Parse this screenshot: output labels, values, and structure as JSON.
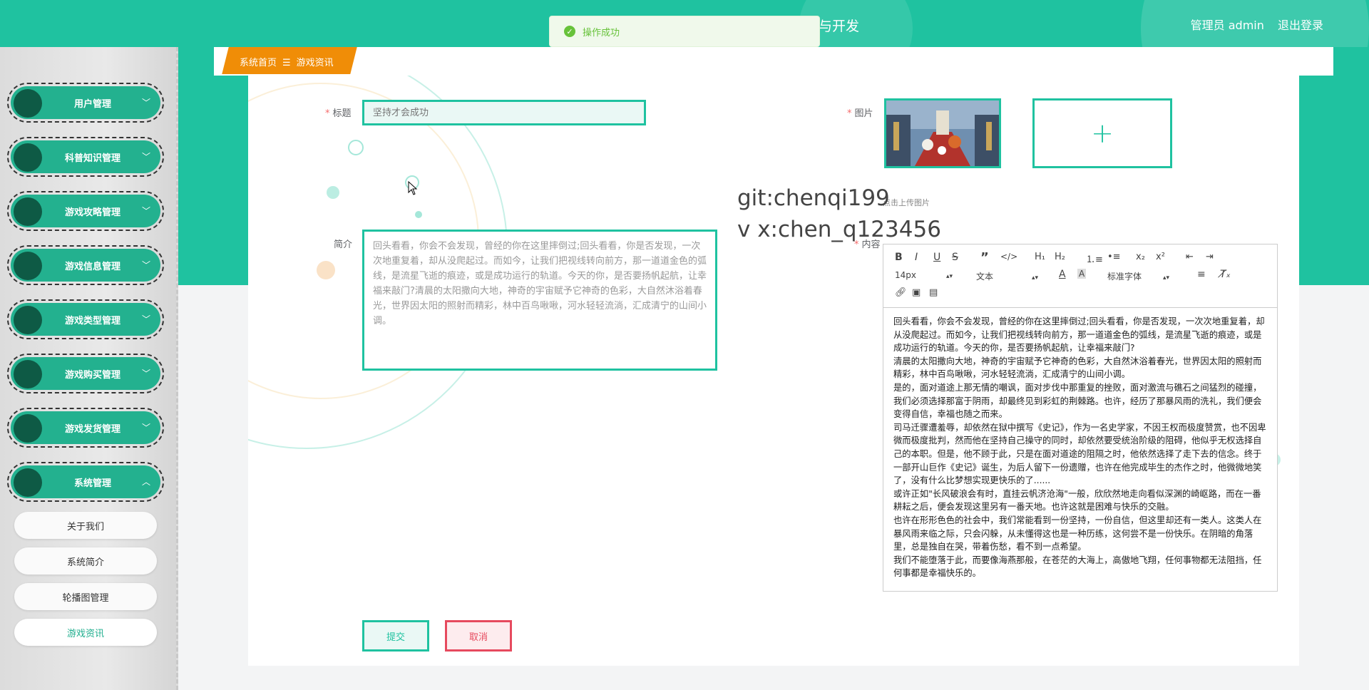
{
  "header": {
    "app_title_fragment": "与开发",
    "user_label": "管理员 admin",
    "logout_label": "退出登录"
  },
  "toast": {
    "message": "操作成功"
  },
  "sidebar": {
    "menus": [
      {
        "label": "用户管理",
        "expanded": false
      },
      {
        "label": "科普知识管理",
        "expanded": false
      },
      {
        "label": "游戏攻略管理",
        "expanded": false
      },
      {
        "label": "游戏信息管理",
        "expanded": false
      },
      {
        "label": "游戏类型管理",
        "expanded": false
      },
      {
        "label": "游戏购买管理",
        "expanded": false
      },
      {
        "label": "游戏发货管理",
        "expanded": false
      },
      {
        "label": "系统管理",
        "expanded": true
      }
    ],
    "sub_items": [
      {
        "label": "关于我们"
      },
      {
        "label": "系统简介"
      },
      {
        "label": "轮播图管理"
      },
      {
        "label": "游戏资讯",
        "active": true
      }
    ]
  },
  "breadcrumb": {
    "home": "系统首页",
    "separator": "☰",
    "current": "游戏资讯"
  },
  "form": {
    "title_label": "标题",
    "title_placeholder": "坚持才会成功",
    "image_label": "图片",
    "upload_tip": "点击上传图片",
    "intro_label": "简介",
    "intro_value": "回头看看，你会不会发现，曾经的你在这里摔倒过;回头看看，你是否发现，一次次地重复着，却从没爬起过。而如今，让我们把视线转向前方，那一道道金色的弧线，是流星飞逝的痕迹，或是成功运行的轨道。今天的你，是否要扬帆起航，让幸福来敲门?清晨的太阳撒向大地，神奇的宇宙赋予它神奇的色彩，大自然沐浴着春光，世界因太阳的照射而精彩，林中百鸟啾啾，河水轻轻流淌，汇成清宁的山间小调。",
    "content_label": "内容",
    "submit_label": "提交",
    "cancel_label": "取消"
  },
  "watermark": {
    "line1": "git:chenqi199",
    "line2": "v x:chen_q123456"
  },
  "editor": {
    "font_size": "14px",
    "block_type": "文本",
    "font_family": "标准字体",
    "paragraphs": [
      "回头看看，你会不会发现，曾经的你在这里摔倒过;回头看看，你是否发现，一次次地重复着，却从没爬起过。而如今，让我们把视线转向前方，那一道道金色的弧线，是流星飞逝的痕迹，或是成功运行的轨道。今天的你，是否要扬帆起航，让幸福来敲门?",
      "清晨的太阳撒向大地，神奇的宇宙赋予它神奇的色彩，大自然沐浴着春光，世界因太阳的照射而精彩，林中百鸟啾啾，河水轻轻流淌，汇成清宁的山间小调。",
      "是的，面对道途上那无情的嘲讽，面对步伐中那重复的挫败，面对激流与礁石之间猛烈的碰撞，我们必须选择那富于阴雨，却最终见到彩虹的荆棘路。也许，经历了那暴风雨的洗礼，我们便会变得自信，幸福也随之而来。",
      "司马迁骤遭羞辱，却依然在狱中撰写《史记》，作为一名史学家，不因王权而极度赞赏，也不因卑微而极度批判，然而他在坚持自己操守的同时，却依然要受统治阶级的阻碍，他似乎无权选择自己的本职。但是，他不顾于此，只是在面对道途的阻隔之时，他依然选择了走下去的信念。终于一部开山巨作《史记》诞生，为后人留下一份遗赠，也许在他完成毕生的杰作之时，他微微地笑了，没有什么比梦想实现更快乐的了......",
      "或许正如\"长风破浪会有时，直挂云帆济沧海\"一般，欣欣然地走向看似深渊的崎岖路，而在一番耕耘之后，便会发现这里另有一番天地。也许这就是困难与快乐的交融。",
      "也许在形形色色的社会中，我们常能看到一份坚持，一份自信，但这里却还有一类人。这类人在暴风雨来临之际，只会闪躲，从未懂得这也是一种历练，这何尝不是一份快乐。在阴暗的角落里，总是独自在哭，带着伤愁，看不到一点希望。",
      "我们不能堕落于此，而要像海燕那般，在苍茫的大海上，高傲地飞翔，任何事物都无法阻挡，任何事都是幸福快乐的。"
    ]
  },
  "colors": {
    "primary": "#1fc2a0",
    "breadcrumb": "#f08d07",
    "danger": "#e64a5e",
    "success": "#67c23a"
  }
}
